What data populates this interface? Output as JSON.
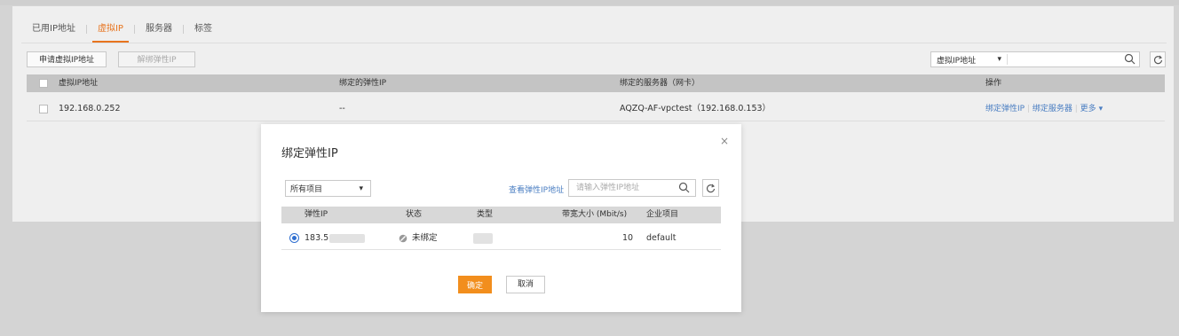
{
  "tabs": [
    "已用IP地址",
    "虚拟IP",
    "服务器",
    "标签"
  ],
  "toolbar": {
    "apply_label": "申请虚拟IP地址",
    "unbind_label": "解绑弹性IP"
  },
  "filter": {
    "select_value": "虚拟IP地址"
  },
  "table": {
    "headers": [
      "虚拟IP地址",
      "绑定的弹性IP",
      "绑定的服务器（网卡）",
      "操作"
    ],
    "row": {
      "ip": "192.168.0.252",
      "eip": "--",
      "server": "AQZQ-AF-vpctest（192.168.0.153）",
      "actions": [
        "绑定弹性IP",
        "绑定服务器",
        "更多"
      ]
    }
  },
  "modal": {
    "title": "绑定弹性IP",
    "close": "×",
    "project_select": "所有项目",
    "view_link": "查看弹性IP地址",
    "search_placeholder": "请输入弹性IP地址",
    "headers": [
      "弹性IP",
      "状态",
      "类型",
      "带宽大小 (Mbit/s)",
      "企业项目"
    ],
    "row": {
      "eip": "183.5",
      "status": "未绑定",
      "bandwidth": "10",
      "project": "default"
    },
    "ok_label": "确定",
    "cancel_label": "取消"
  },
  "colors": {
    "accent": "#e8741e",
    "primary_button": "#f28e1d",
    "link": "#4a7ec2"
  },
  "icons": [
    "search-icon",
    "refresh-icon",
    "close-icon",
    "chevron-down-icon",
    "unbound-status-icon"
  ]
}
